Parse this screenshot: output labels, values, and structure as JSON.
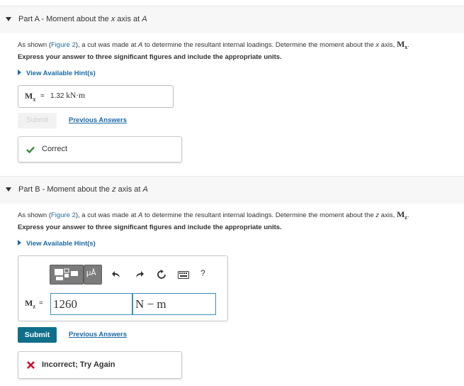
{
  "part_a": {
    "label": "Part A",
    "title_prefix": " - Moment about the ",
    "title_axis": "x",
    "title_suffix": " axis at ",
    "title_point": "A",
    "prompt_pre": "As shown (",
    "prompt_link": "Figure 2",
    "prompt_mid": "), a cut was made at ",
    "prompt_point": "A",
    "prompt_post": " to determine the resultant internal loadings. Determine the moment about the ",
    "prompt_axis": "x",
    "prompt_end": " axis, ",
    "prompt_symbol": "M",
    "prompt_sub": "x",
    "instruction": "Express your answer to three significant figures and include the appropriate units.",
    "hint_label": "View Available Hint(s)",
    "answer_symbol": "M",
    "answer_sub": "x",
    "answer_eq": "=",
    "answer_value": "1.32",
    "answer_units": "kN·m",
    "submit_label": "Submit",
    "previous_answers_label": "Previous Answers",
    "feedback_text": "Correct",
    "feedback_color": "#3c8c3c"
  },
  "part_b": {
    "label": "Part B",
    "title_prefix": " - Moment about the ",
    "title_axis": "z",
    "title_suffix": " axis at ",
    "title_point": "A",
    "prompt_pre": "As shown (",
    "prompt_link": "Figure 2",
    "prompt_mid": "),  a cut was made at ",
    "prompt_point": "A",
    "prompt_post": " to determine the resultant internal loadings. Determine the moment about the ",
    "prompt_axis": "z",
    "prompt_end": " axis, ",
    "prompt_symbol": "M",
    "prompt_sub": "z",
    "instruction": "Express your answer to three significant figures and include the appropriate units.",
    "hint_label": "View Available Hint(s)",
    "toolbar": {
      "templates_icon": "templates-icon",
      "units_label": "μÅ",
      "undo_icon": "undo-icon",
      "redo_icon": "redo-icon",
      "reset_icon": "reset-icon",
      "keyboard_icon": "keyboard-icon",
      "help_label": "?"
    },
    "answer_symbol": "M",
    "answer_sub": "z",
    "answer_eq": "=",
    "value_input": "1260",
    "units_input": "N − m",
    "submit_label": "Submit",
    "previous_answers_label": "Previous Answers",
    "feedback_text": "Incorrect; Try Again",
    "feedback_color": "#c8102e"
  },
  "colors": {
    "link": "#1a6aa6",
    "submit_bg": "#0f6f8a"
  }
}
